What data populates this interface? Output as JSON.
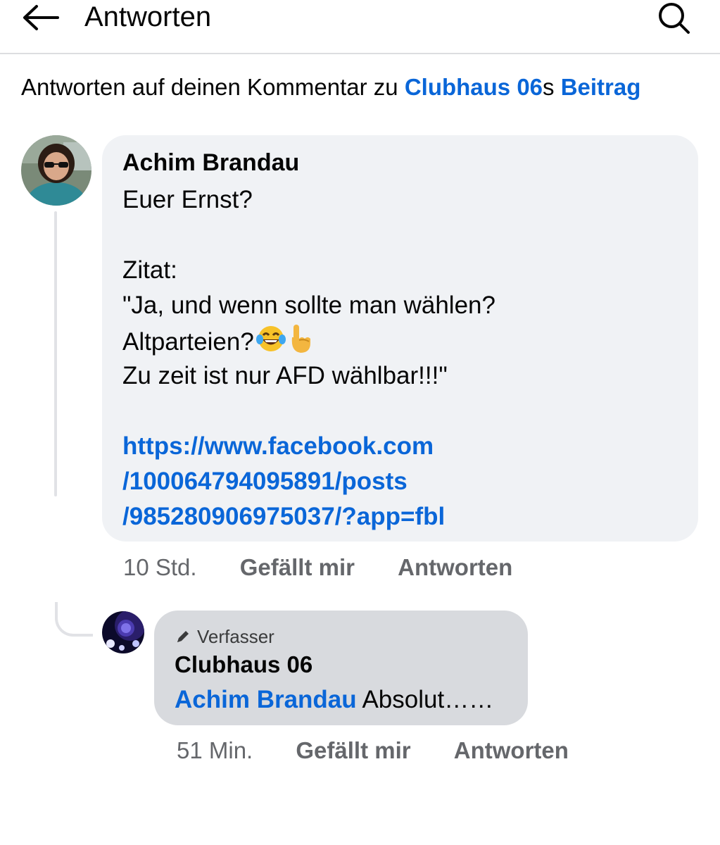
{
  "header": {
    "title": "Antworten",
    "back_icon": "arrow-left-icon",
    "search_icon": "search-icon"
  },
  "context": {
    "prefix": "Antworten auf deinen Kommentar zu ",
    "page_name": "Clubhaus 06",
    "possessive": "s ",
    "post_link": "Beitrag"
  },
  "comment": {
    "author": "Achim Brandau",
    "lines": [
      "Euer Ernst?",
      "",
      "Zitat:",
      "\"Ja, und wenn sollte man wählen?",
      "Altparteien?",
      "Zu zeit ist nur AFD wählbar!!!\"",
      ""
    ],
    "emojis": [
      "face-with-tears-of-joy",
      "index-pointing-up"
    ],
    "url_lines": [
      "https://www.facebook.com",
      "/100064794095891/posts",
      "/985280906975037/?app=fbl"
    ],
    "time": "10 Std.",
    "like_label": "Gefällt mir",
    "reply_label": "Antworten"
  },
  "reply": {
    "badge": "Verfasser",
    "badge_icon": "pencil-icon",
    "author": "Clubhaus 06",
    "mention": "Achim Brandau",
    "text": " Absolut……",
    "time": "51 Min.",
    "like_label": "Gefällt mir",
    "reply_label": "Antworten"
  },
  "colors": {
    "link": "#0a66d8",
    "bubble": "#f0f2f5",
    "reply_bubble": "#d8dade",
    "meta_text": "#65676b"
  }
}
